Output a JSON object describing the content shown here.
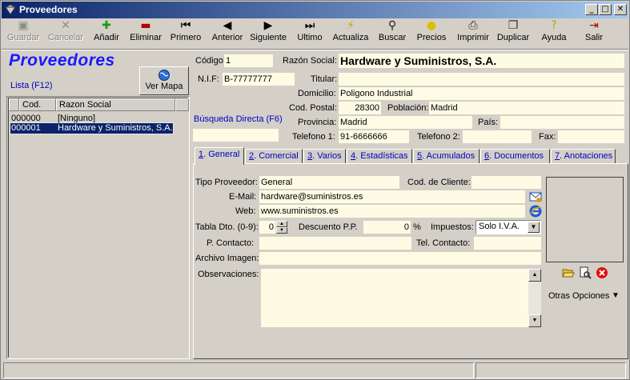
{
  "window": {
    "title": "Proveedores",
    "controls": [
      "_",
      "□",
      "✕"
    ]
  },
  "toolbar": {
    "items": [
      {
        "label": "Guardar",
        "icon": "save-icon",
        "glyph": "▣",
        "color": "#8a8a8a",
        "enabled": false
      },
      {
        "label": "Cancelar",
        "icon": "cancel-icon",
        "glyph": "✕",
        "color": "#8a8a8a",
        "enabled": false
      },
      {
        "label": "Añadir",
        "icon": "plus-icon",
        "glyph": "✚",
        "color": "#1a9a1a",
        "enabled": true
      },
      {
        "label": "Eliminar",
        "icon": "minus-icon",
        "glyph": "▬",
        "color": "#b00000",
        "enabled": true
      },
      {
        "label": "Primero",
        "icon": "first-record-icon",
        "glyph": "⏮",
        "color": "#000000",
        "enabled": true
      },
      {
        "label": "Anterior",
        "icon": "previous-record-icon",
        "glyph": "◀",
        "color": "#000000",
        "enabled": true
      },
      {
        "label": "Siguiente",
        "icon": "next-record-icon",
        "glyph": "▶",
        "color": "#000000",
        "enabled": true
      },
      {
        "label": "Ultimo",
        "icon": "last-record-icon",
        "glyph": "⏭",
        "color": "#000000",
        "enabled": true
      },
      {
        "label": "Actualiza",
        "icon": "refresh-lightning-icon",
        "glyph": "⚡",
        "color": "#c8a000",
        "enabled": true
      },
      {
        "label": "Buscar",
        "icon": "binoculars-icon",
        "glyph": "⚲",
        "color": "#202020",
        "enabled": true
      },
      {
        "label": "Precios",
        "icon": "coins-icon",
        "glyph": "●",
        "color": "#d8c000",
        "enabled": true
      },
      {
        "label": "Imprimir",
        "icon": "printer-icon",
        "glyph": "⎙",
        "color": "#303030",
        "enabled": true
      },
      {
        "label": "Duplicar",
        "icon": "duplicate-icon",
        "glyph": "❐",
        "color": "#303030",
        "enabled": true
      },
      {
        "label": "Ayuda",
        "icon": "help-icon",
        "glyph": "?",
        "color": "#c8a000",
        "enabled": true
      },
      {
        "label": "Salir",
        "icon": "exit-door-icon",
        "glyph": "⇥",
        "color": "#b00000",
        "enabled": true
      }
    ]
  },
  "left": {
    "title": "Proveedores",
    "lista_label": "Lista (F12)",
    "ver_mapa": "Ver Mapa",
    "busqueda": "Búsqueda Directa (F6)",
    "list": {
      "headers": [
        "Cod.",
        "Razon Social"
      ],
      "rows": [
        {
          "code": "000000",
          "name": "[Ninguno]",
          "selected": false
        },
        {
          "code": "000001",
          "name": "Hardware y Suministros, S.A.",
          "selected": true
        }
      ]
    }
  },
  "form": {
    "codigo_label": "Código:",
    "codigo": "1",
    "razon_label": "Razón Social:",
    "razon": "Hardware y Suministros, S.A.",
    "nif_label": "N.I.F:",
    "nif": "B-77777777",
    "titular_label": "Titular:",
    "titular": "",
    "domicilio_label": "Domicilio:",
    "domicilio": "Poligono Industrial",
    "cp_label": "Cod. Postal:",
    "cp": "28300",
    "poblacion_label": "Población:",
    "poblacion": "Madrid",
    "provincia_label": "Provincia:",
    "provincia": "Madrid",
    "pais_label": "País:",
    "pais": "",
    "tel1_label": "Telefono 1:",
    "tel1": "91-6666666",
    "tel2_label": "Telefono 2:",
    "tel2": "",
    "fax_label": "Fax:",
    "fax": ""
  },
  "tabs": [
    {
      "num": "1",
      "label": ". General",
      "active": true
    },
    {
      "num": "2",
      "label": ". Comercial",
      "active": false
    },
    {
      "num": "3",
      "label": ". Varios",
      "active": false
    },
    {
      "num": "4",
      "label": ". Estadísticas",
      "active": false
    },
    {
      "num": "5",
      "label": ". Acumulados",
      "active": false
    },
    {
      "num": "6",
      "label": ". Documentos",
      "active": false
    },
    {
      "num": "7",
      "label": ". Anotaciones",
      "active": false
    }
  ],
  "general": {
    "tipo_label": "Tipo Proveedor:",
    "tipo": "General",
    "codcliente_label": "Cod. de Cliente:",
    "codcliente": "",
    "email_label": "E-Mail:",
    "email": "hardware@suministros.es",
    "web_label": "Web:",
    "web": "www.suministros.es",
    "tabla_label": "Tabla Dto. (0-9):",
    "tabla": "0",
    "descuento_label": "Descuento P.P.",
    "descuento": "0",
    "pct": "%",
    "impuestos_label": "Impuestos:",
    "impuestos": "Solo I.V.A.",
    "contacto_label": "P. Contacto:",
    "contacto": "",
    "telcontacto_label": "Tel. Contacto:",
    "telcontacto": "",
    "archivo_label": "Archivo Imagen:",
    "archivo": "",
    "obs_label": "Observaciones:",
    "obs": "",
    "otras": "Otras Opciones"
  }
}
